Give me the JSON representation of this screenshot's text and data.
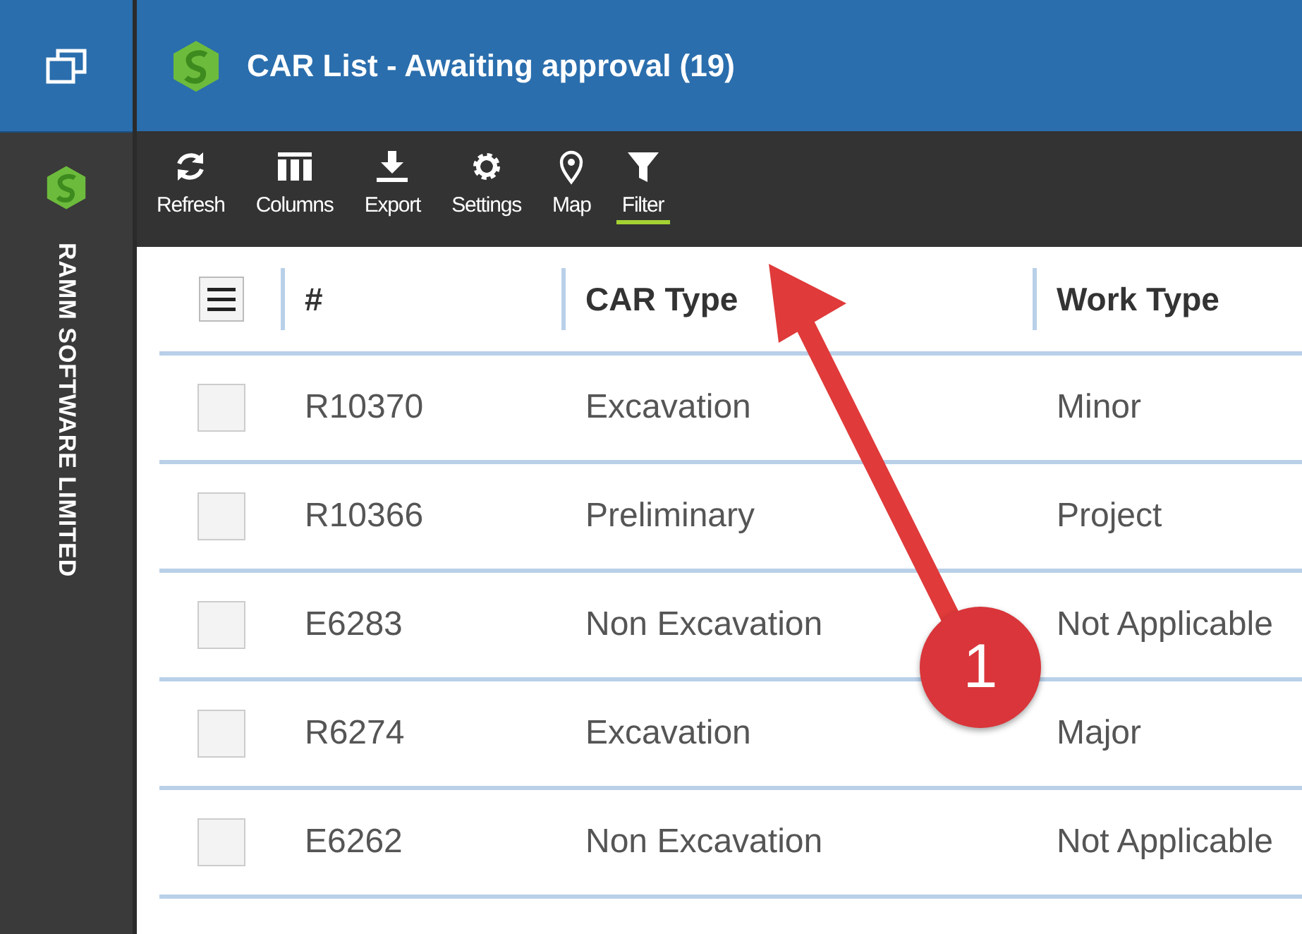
{
  "sidebar": {
    "company": "RAMM SOFTWARE LIMITED"
  },
  "header": {
    "title": "CAR List - Awaiting approval (19)"
  },
  "toolbar": [
    {
      "kind": "refresh",
      "label": "Refresh",
      "selected": false
    },
    {
      "kind": "columns",
      "label": "Columns",
      "selected": false
    },
    {
      "kind": "export",
      "label": "Export",
      "selected": false
    },
    {
      "kind": "settings",
      "label": "Settings",
      "selected": false
    },
    {
      "kind": "map",
      "label": "Map",
      "selected": false
    },
    {
      "kind": "filter",
      "label": "Filter",
      "selected": true
    }
  ],
  "table": {
    "columns": [
      "#",
      "CAR Type",
      "Work Type"
    ],
    "rows": [
      {
        "checked": false,
        "cells": [
          "R10370",
          "Excavation",
          "Minor"
        ]
      },
      {
        "checked": false,
        "cells": [
          "R10366",
          "Preliminary",
          "Project"
        ]
      },
      {
        "checked": false,
        "cells": [
          "E6283",
          "Non Excavation",
          "Not Applicable"
        ]
      },
      {
        "checked": false,
        "cells": [
          "R6274",
          "Excavation",
          "Major"
        ]
      },
      {
        "checked": false,
        "cells": [
          "E6262",
          "Non Excavation",
          "Not Applicable"
        ]
      }
    ]
  },
  "annotation": {
    "number": "1"
  }
}
